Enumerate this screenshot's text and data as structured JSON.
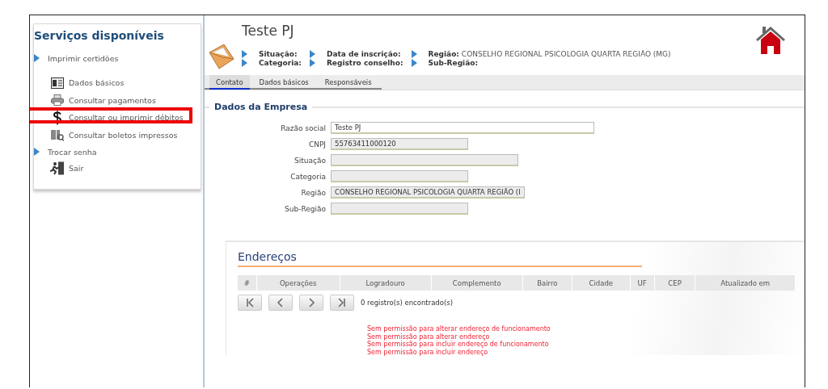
{
  "sidebar": {
    "title": "Serviços disponíveis",
    "items": [
      {
        "kind": "section",
        "label": "Imprimir certidões",
        "highlighted": false
      },
      {
        "kind": "link",
        "label": "Dados básicos",
        "highlighted": false
      },
      {
        "kind": "link",
        "label": "Consultar pagamentos",
        "highlighted": false
      },
      {
        "kind": "link",
        "label": "Consultar ou imprimir débitos",
        "highlighted": true
      },
      {
        "kind": "link",
        "label": "Consultar boletos impressos",
        "highlighted": false
      },
      {
        "kind": "section",
        "label": "Trocar senha",
        "highlighted": false
      },
      {
        "kind": "link",
        "label": "Sair",
        "highlighted": false
      }
    ]
  },
  "header": {
    "title": "Teste PJ",
    "info": [
      {
        "label": "Situação:"
      },
      {
        "label": "Data de inscrição:"
      },
      {
        "label": "Região:",
        "value": "CONSELHO REGIONAL PSICOLOGIA QUARTA REGIÃO (MG)"
      },
      {
        "label": "Categoria:"
      },
      {
        "label": "Registro conselho:"
      },
      {
        "label": "Sub-Região:"
      }
    ]
  },
  "tabs": [
    {
      "label": "Contato",
      "selected": true
    },
    {
      "label": "Dados básicos",
      "selected": false
    },
    {
      "label": "Responsáveis",
      "selected": false
    }
  ],
  "company": {
    "title": "Dados da Empresa",
    "fields": [
      {
        "label": "Razão social",
        "value": "Teste PJ",
        "disabled": false
      },
      {
        "label": "CNPJ",
        "value": "55763411000120",
        "disabled": true
      },
      {
        "label": "Situação",
        "disabled": true
      },
      {
        "label": "Categoria",
        "disabled": true
      },
      {
        "label": "Região",
        "value": "CONSELHO REGIONAL PSICOLOGIA QUARTA REGIÃO (I",
        "disabled": true
      },
      {
        "label": "Sub-Região",
        "disabled": true
      }
    ]
  },
  "addresses": {
    "title": "Endereços",
    "columns": [
      "#",
      "Operações",
      "Logradouro",
      "Complemento",
      "Bairro",
      "Cidade",
      "UF",
      "CEP",
      "Atualizado em"
    ],
    "count": "0 registro(s) encontrado(s)",
    "messages": [
      "Sem permissão para alterar endereço de funcionamento",
      "Sem permissão para alterar endereço",
      "Sem permissão para incluir endereço de funcionamento",
      "Sem permissão para incluir endereço"
    ]
  }
}
